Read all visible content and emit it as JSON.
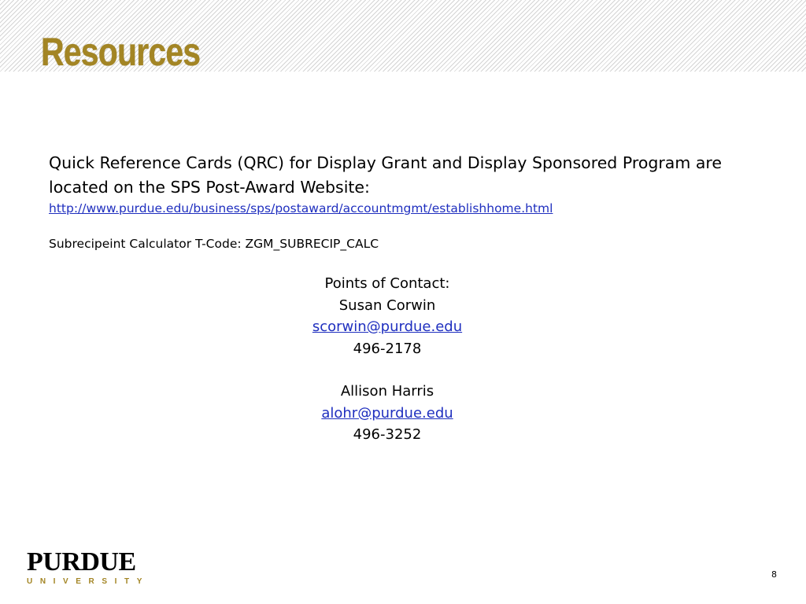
{
  "slide": {
    "title": "Resources",
    "qrc_line1": "Quick Reference Cards (QRC) for Display Grant and Display Sponsored Program are",
    "qrc_line2": "located on the SPS Post-Award Website:",
    "qrc_url": "http://www.purdue.edu/business/sps/postaward/accountmgmt/establishhome.html",
    "tcode": "Subrecipeint Calculator T-Code:  ZGM_SUBRECIP_CALC",
    "contacts_heading": "Points of Contact:",
    "contacts": [
      {
        "name": "Susan Corwin",
        "email": "scorwin@purdue.edu",
        "phone": "496-2178"
      },
      {
        "name": "Allison Harris",
        "email": "alohr@purdue.edu",
        "phone": "496-3252"
      }
    ],
    "logo_word": "PURDUE",
    "logo_sub": "UNIVERSITY",
    "page_number": "8"
  },
  "colors": {
    "title_gold": "#a38524",
    "link_blue": "#1f2fbf"
  }
}
